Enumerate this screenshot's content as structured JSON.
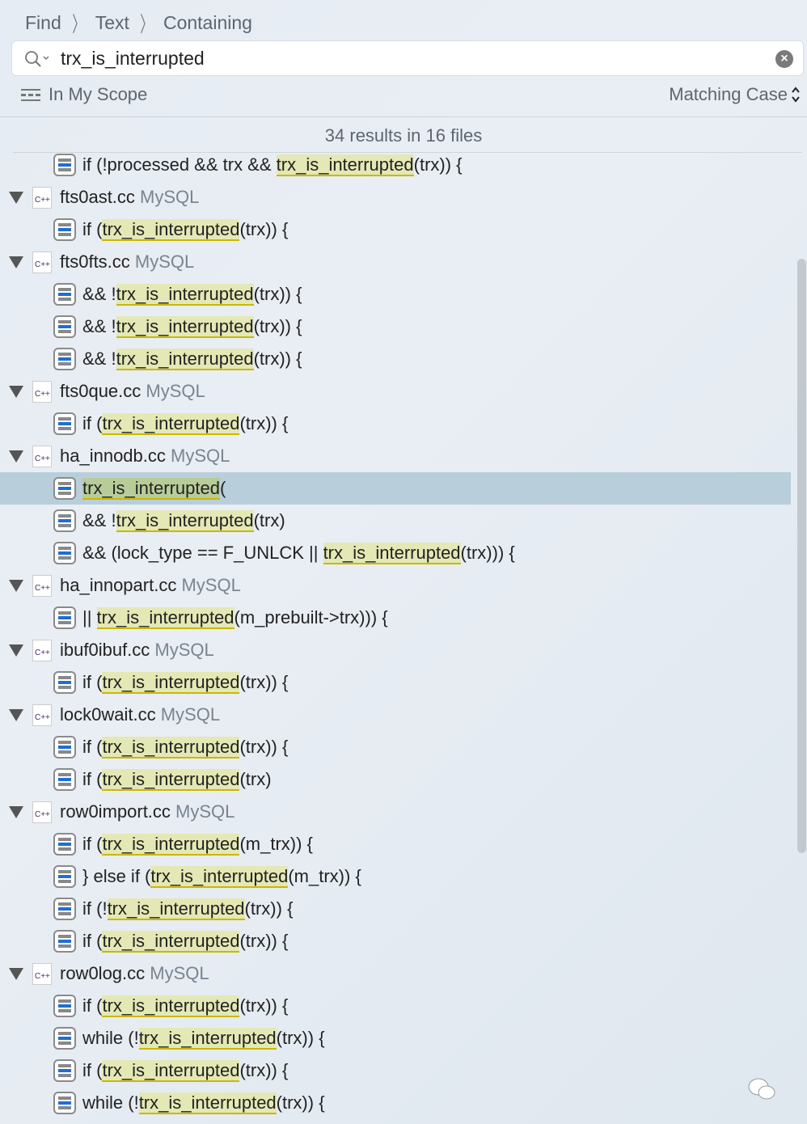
{
  "breadcrumb": [
    "Find",
    "Text",
    "Containing"
  ],
  "search": {
    "value": "trx_is_interrupted",
    "clear_icon": "clear-icon",
    "search_icon": "magnifier-dropdown-icon"
  },
  "scope": {
    "label": "In My Scope",
    "icon": "scope-icon"
  },
  "matching": {
    "label": "Matching Case",
    "icon": "up-down-chevron-icon"
  },
  "summary": "34 results in 16 files",
  "highlight_color": "#e4e8b4",
  "selected_color": "#b9cedb",
  "rows": [
    {
      "type": "match",
      "before": "if (!processed && trx && ",
      "hit": "trx_is_interrupted",
      "after": "(trx)) {"
    },
    {
      "type": "file",
      "name": "fts0ast.cc",
      "project": "MySQL"
    },
    {
      "type": "match",
      "before": "if (",
      "hit": "trx_is_interrupted",
      "after": "(trx)) {"
    },
    {
      "type": "file",
      "name": "fts0fts.cc",
      "project": "MySQL"
    },
    {
      "type": "match",
      "before": "&& !",
      "hit": "trx_is_interrupted",
      "after": "(trx)) {"
    },
    {
      "type": "match",
      "before": "&& !",
      "hit": "trx_is_interrupted",
      "after": "(trx)) {"
    },
    {
      "type": "match",
      "before": "&& !",
      "hit": "trx_is_interrupted",
      "after": "(trx)) {"
    },
    {
      "type": "file",
      "name": "fts0que.cc",
      "project": "MySQL"
    },
    {
      "type": "match",
      "before": "if (",
      "hit": "trx_is_interrupted",
      "after": "(trx)) {"
    },
    {
      "type": "file",
      "name": "ha_innodb.cc",
      "project": "MySQL"
    },
    {
      "type": "match",
      "before": "",
      "hit": "trx_is_interrupted",
      "after": "(",
      "selected": true
    },
    {
      "type": "match",
      "before": "&& !",
      "hit": "trx_is_interrupted",
      "after": "(trx)"
    },
    {
      "type": "match",
      "before": "&& (lock_type == F_UNLCK || ",
      "hit": "trx_is_interrupted",
      "after": "(trx))) {"
    },
    {
      "type": "file",
      "name": "ha_innopart.cc",
      "project": "MySQL"
    },
    {
      "type": "match",
      "before": "|| ",
      "hit": "trx_is_interrupted",
      "after": "(m_prebuilt->trx))) {"
    },
    {
      "type": "file",
      "name": "ibuf0ibuf.cc",
      "project": "MySQL"
    },
    {
      "type": "match",
      "before": "if (",
      "hit": "trx_is_interrupted",
      "after": "(trx)) {"
    },
    {
      "type": "file",
      "name": "lock0wait.cc",
      "project": "MySQL"
    },
    {
      "type": "match",
      "before": "if (",
      "hit": "trx_is_interrupted",
      "after": "(trx)) {"
    },
    {
      "type": "match",
      "before": "if (",
      "hit": "trx_is_interrupted",
      "after": "(trx)"
    },
    {
      "type": "file",
      "name": "row0import.cc",
      "project": "MySQL"
    },
    {
      "type": "match",
      "before": "if (",
      "hit": "trx_is_interrupted",
      "after": "(m_trx)) {"
    },
    {
      "type": "match",
      "before": "} else if (",
      "hit": "trx_is_interrupted",
      "after": "(m_trx)) {"
    },
    {
      "type": "match",
      "before": "if (!",
      "hit": "trx_is_interrupted",
      "after": "(trx)) {"
    },
    {
      "type": "match",
      "before": "if (",
      "hit": "trx_is_interrupted",
      "after": "(trx)) {"
    },
    {
      "type": "file",
      "name": "row0log.cc",
      "project": "MySQL"
    },
    {
      "type": "match",
      "before": "if (",
      "hit": "trx_is_interrupted",
      "after": "(trx)) {"
    },
    {
      "type": "match",
      "before": "while (!",
      "hit": "trx_is_interrupted",
      "after": "(trx)) {"
    },
    {
      "type": "match",
      "before": "if (",
      "hit": "trx_is_interrupted",
      "after": "(trx)) {"
    },
    {
      "type": "match",
      "before": "while (!",
      "hit": "trx_is_interrupted",
      "after": "(trx)) {"
    }
  ]
}
